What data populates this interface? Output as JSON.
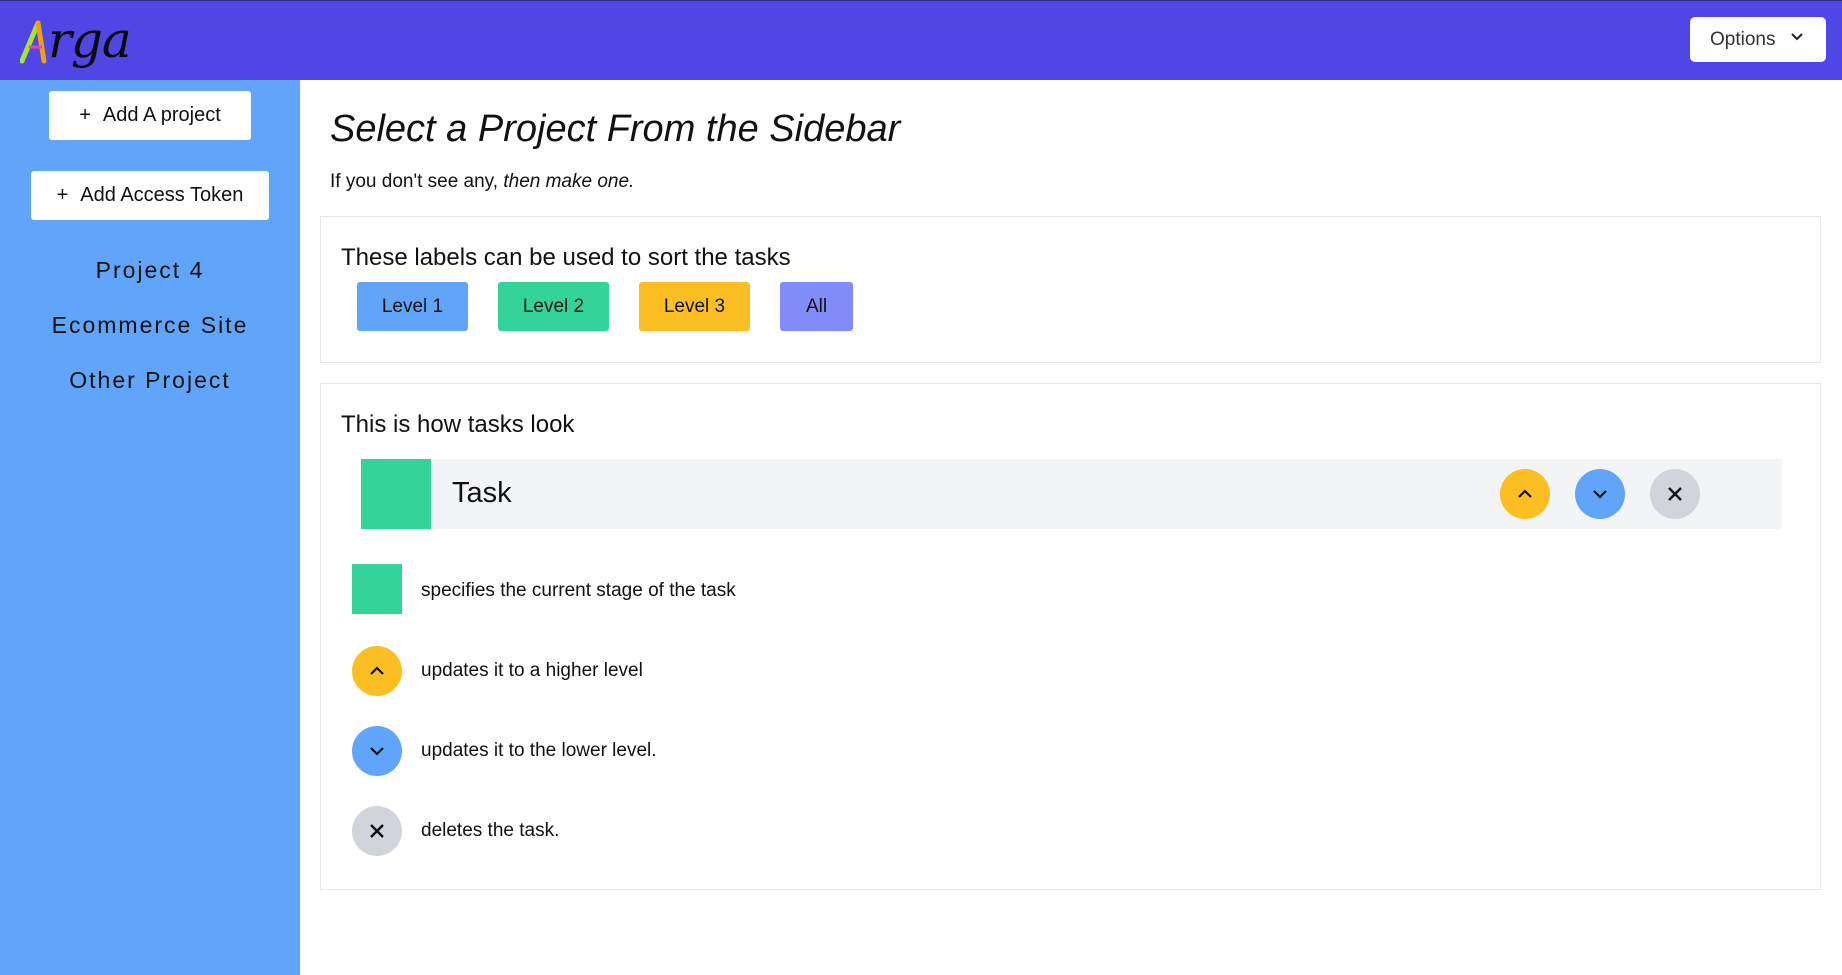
{
  "header": {
    "logo_text": "rga",
    "options_label": "Options"
  },
  "sidebar": {
    "add_project_label": "Add A project",
    "add_token_label": "Add Access Token",
    "projects": [
      "Project 4",
      "Ecommerce Site",
      "Other Project"
    ]
  },
  "main": {
    "title": "Select a Project From the Sidebar",
    "subtitle_plain": "If you don't see any,",
    "subtitle_emphasis": "then make one."
  },
  "labels_card": {
    "title": "These labels can be used to sort the tasks",
    "labels": [
      {
        "text": "Level 1",
        "color": "#60a5fa"
      },
      {
        "text": "Level 2",
        "color": "#34d399"
      },
      {
        "text": "Level 3",
        "color": "#fbbf24"
      },
      {
        "text": "All",
        "color": "#818cf8"
      }
    ]
  },
  "tasks_card": {
    "title": "This is how tasks look",
    "example_task": "Task",
    "legend": [
      {
        "icon": "stage-square",
        "text": "specifies the current stage of the task"
      },
      {
        "icon": "chevron-up-icon",
        "text": "updates it to a higher level"
      },
      {
        "icon": "chevron-down-icon",
        "text": "updates it to the lower level."
      },
      {
        "icon": "close-icon",
        "text": "deletes the task."
      }
    ]
  },
  "colors": {
    "header": "#4f46e5",
    "sidebar": "#60a5fa",
    "stage": "#34d399",
    "up": "#fbbf24",
    "down": "#60a5fa",
    "delete": "#d1d5db"
  }
}
